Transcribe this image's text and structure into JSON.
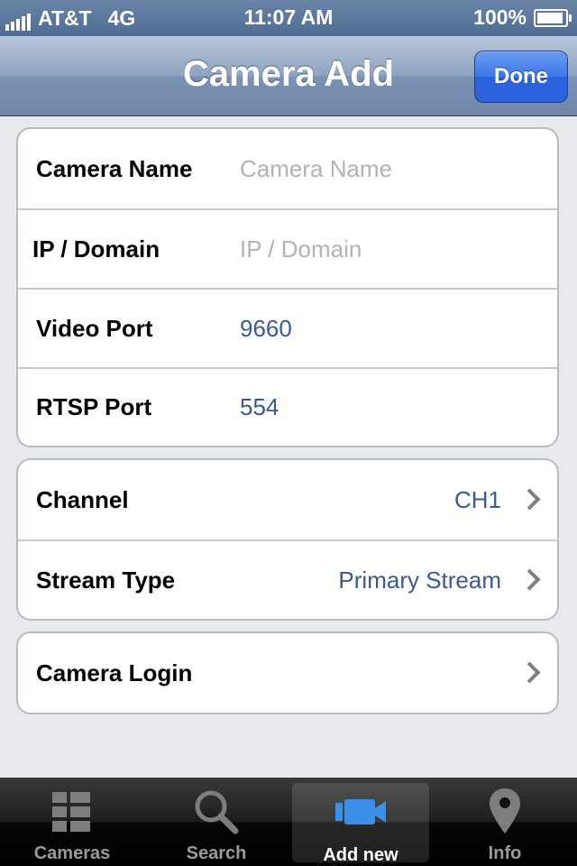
{
  "status_bar": {
    "carrier": "AT&T",
    "network": "4G",
    "time": "11:07 AM",
    "battery": "100%"
  },
  "nav": {
    "title": "Camera Add",
    "done_label": "Done"
  },
  "connection_group": [
    {
      "label": "Camera Name",
      "placeholder": "Camera Name",
      "value": ""
    },
    {
      "label": "IP / Domain",
      "placeholder": "IP / Domain",
      "value": ""
    },
    {
      "label": "Video Port",
      "value": "9660"
    },
    {
      "label": "RTSP Port",
      "value": "554"
    }
  ],
  "stream_group": [
    {
      "label": "Channel",
      "value": "CH1"
    },
    {
      "label": "Stream Type",
      "value": "Primary Stream"
    }
  ],
  "login_group": [
    {
      "label": "Camera Login"
    }
  ],
  "tabs": [
    {
      "label": "Cameras",
      "icon": "grid-list-icon"
    },
    {
      "label": "Search",
      "icon": "magnifier-icon"
    },
    {
      "label": "Add new",
      "icon": "video-camera-icon",
      "active": true
    },
    {
      "label": "Info",
      "icon": "map-pin-icon"
    }
  ],
  "colors": {
    "nav": "#7b93b4",
    "done_button": "#2d63dc",
    "value_text": "#3b5a8e",
    "placeholder": "#b3b3b3",
    "tab_active_icon": "#3a8fe8"
  }
}
